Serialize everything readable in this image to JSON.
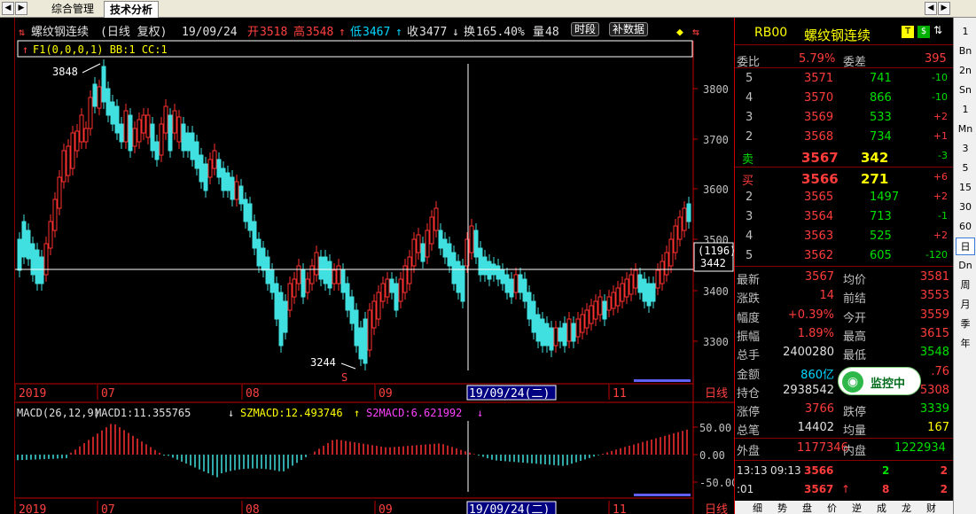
{
  "tabs": {
    "t1": "综合管理",
    "t2": "技术分析"
  },
  "header": {
    "name": "螺纹钢连续",
    "mode": "(日线 复权)",
    "date": "19/09/24",
    "open_l": "开",
    "open": "3518",
    "high_l": "高",
    "high": "3548",
    "low_l": "低",
    "low": "3467",
    "close_l": "收",
    "close": "3477",
    "turn_l": "换",
    "turn": "165.40%",
    "vol_l": "量",
    "vol": "48",
    "trail": "8"
  },
  "buttons": {
    "timeshare": "时段",
    "extra": "补数据"
  },
  "indicator_line": {
    "text": "F1(0,0,0,1) BB:1 CC:1"
  },
  "kline": {
    "yticks": [
      "3800",
      "3700",
      "3600",
      "3500",
      "3400",
      "3300"
    ],
    "cursor_box": [
      "(1196)",
      "3442"
    ],
    "hi_label": "3848",
    "lo_label": "3244",
    "s_mark": "S",
    "xlabels": [
      "2019",
      "07",
      "08",
      "09",
      "19/09/24(二)",
      "11",
      "日线"
    ]
  },
  "macd": {
    "title": "MACD(26,12,9)",
    "m1": "MACD1:11.355765",
    "m1_arrow": "↓",
    "sz": "SZMACD:12.493746",
    "sz_arrow": "↑",
    "s2": "S2MACD:6.621992",
    "s2_arrow": "↓",
    "yticks": [
      "50.00",
      "0.00",
      "-50.00"
    ],
    "xlabels": [
      "2019",
      "07",
      "08",
      "09",
      "19/09/24(二)",
      "11",
      "日线"
    ]
  },
  "quote": {
    "code": "RB00",
    "name": "螺纹钢连续",
    "weibi_l": "委比",
    "weibi": "5.79%",
    "weicha_l": "委差",
    "weicha": "395",
    "asks": [
      {
        "lv": "5",
        "price": "3571",
        "vol": "741",
        "chg": "-10"
      },
      {
        "lv": "4",
        "price": "3570",
        "vol": "866",
        "chg": "-10"
      },
      {
        "lv": "3",
        "price": "3569",
        "vol": "533",
        "chg": "+2"
      },
      {
        "lv": "2",
        "price": "3568",
        "vol": "734",
        "chg": "+1"
      },
      {
        "lv": "卖",
        "price": "3567",
        "vol": "342",
        "chg": "-3"
      }
    ],
    "bids": [
      {
        "lv": "买",
        "price": "3566",
        "vol": "271",
        "chg": "+6"
      },
      {
        "lv": "2",
        "price": "3565",
        "vol": "1497",
        "chg": "+2"
      },
      {
        "lv": "3",
        "price": "3564",
        "vol": "713",
        "chg": "-1"
      },
      {
        "lv": "4",
        "price": "3563",
        "vol": "525",
        "chg": "+2"
      },
      {
        "lv": "5",
        "price": "3562",
        "vol": "605",
        "chg": "-120"
      }
    ],
    "stats": [
      {
        "l1": "最新",
        "v1": "3567",
        "l2": "均价",
        "v2": "3581"
      },
      {
        "l1": "涨跌",
        "v1": "14",
        "l2": "前结",
        "v2": "3553"
      },
      {
        "l1": "幅度",
        "v1": "+0.39%",
        "l2": "今开",
        "v2": "3559"
      },
      {
        "l1": "振幅",
        "v1": "1.89%",
        "l2": "最高",
        "v2": "3615"
      },
      {
        "l1": "总手",
        "v1": "2400280",
        "l2": "最低",
        "v2": "3548"
      },
      {
        "l1": "金额",
        "v1": "860亿",
        "l2": "",
        "v2": ".76"
      },
      {
        "l1": "持仓",
        "v1": "2938542",
        "l2": "",
        "v2": "5308"
      },
      {
        "l1": "涨停",
        "v1": "3766",
        "l2": "跌停",
        "v2": "3339"
      },
      {
        "l1": "总笔",
        "v1": "14402",
        "l2": "均量",
        "v2": "167"
      }
    ],
    "outer_l": "外盘",
    "outer": "1177346",
    "inner_l": "内盘",
    "inner": "1222934",
    "ticks": [
      {
        "t": "13:13",
        "t2": "09:13",
        "p": "3566",
        "q": "2",
        "f": "2"
      },
      {
        "t": ":01",
        "t2": "",
        "p": "3567",
        "q": "8",
        "f": "2",
        "arrow": "↑"
      }
    ],
    "bottom_tabs": [
      "细",
      "势",
      "盘",
      "价",
      "逆",
      "成",
      "龙",
      "财"
    ]
  },
  "monitor": {
    "label": "监控中"
  },
  "sidebar": [
    "1m",
    "5m",
    "15m",
    "30m",
    "60m",
    "日",
    "周",
    "月",
    "季",
    "年"
  ],
  "sidebar_full": [
    "1",
    "Bn",
    "2n",
    "Sn",
    "1",
    "Mn",
    "3",
    "5",
    "15",
    "30",
    "60",
    "日",
    "Dn",
    "周",
    "月",
    "季",
    "年"
  ]
}
